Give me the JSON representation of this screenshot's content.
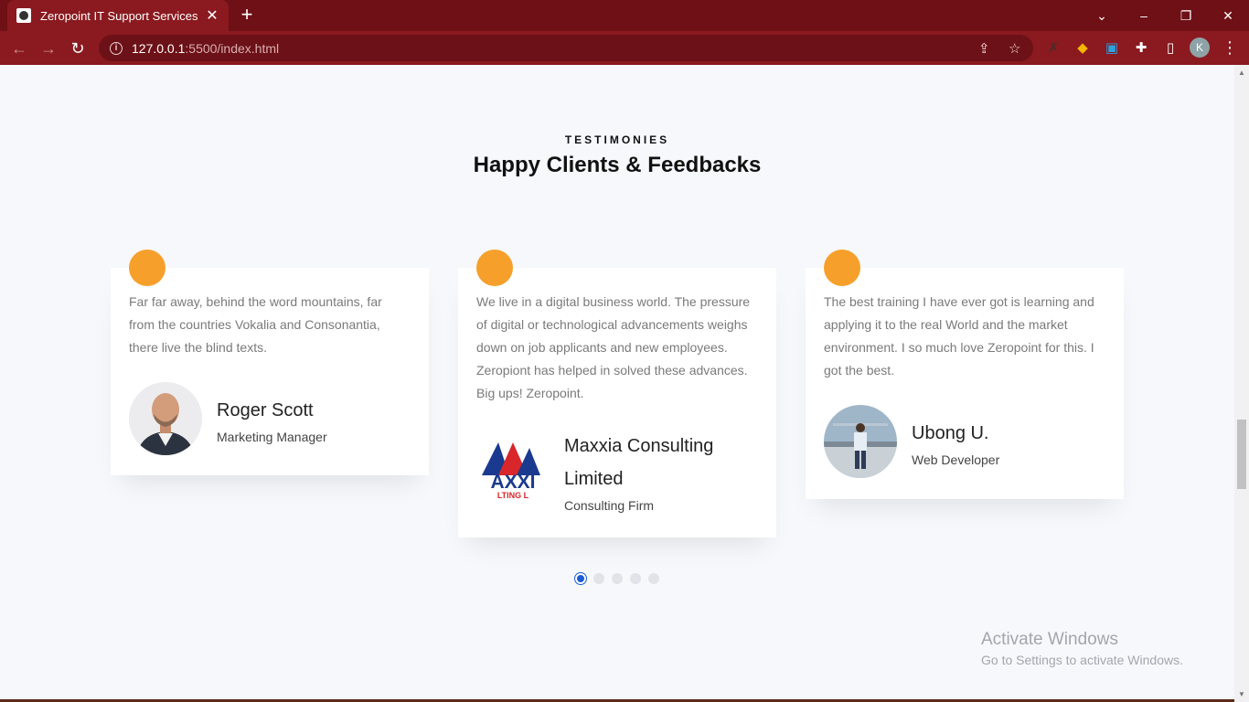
{
  "browser": {
    "tab_title": "Zeropoint IT Support Services",
    "url_host": "127.0.0.1",
    "url_rest": ":5500/index.html",
    "profile_initial": "K"
  },
  "section": {
    "eyebrow": "TESTIMONIES",
    "title": "Happy Clients & Feedbacks"
  },
  "testimonials": [
    {
      "text": "Far far away, behind the word mountains, far from the countries Vokalia and Consonantia, there live the blind texts.",
      "name": "Roger Scott",
      "role": "Marketing Manager"
    },
    {
      "text": "We live in a digital business world. The pressure of digital or technological advancements weighs down on job applicants and new employees. Zeropiont has helped in solved these advances. Big ups! Zeropoint.",
      "name": "Maxxia Consulting Limited",
      "role": "Consulting Firm",
      "logo_text": "AXXI",
      "logo_sub": "LTING L"
    },
    {
      "text": "The best training I have ever got is learning and applying it to the real World and the market environment. I so much love Zeropoint for this. I got the best.",
      "name": "Ubong U.",
      "role": "Web Developer"
    }
  ],
  "pagination": {
    "count": 5,
    "active": 0
  },
  "watermark": {
    "title": "Activate Windows",
    "subtitle": "Go to Settings to activate Windows."
  },
  "colors": {
    "accent": "#f6a02b",
    "active_dot": "#1b5bd7",
    "chrome": "#8a1a1f"
  }
}
